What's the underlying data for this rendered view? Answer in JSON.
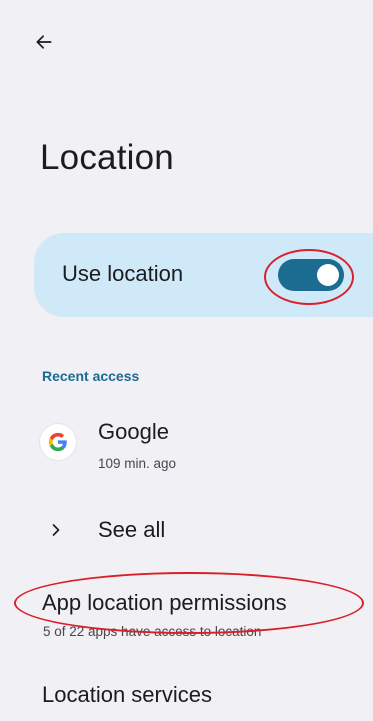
{
  "header": {
    "back_icon": "arrow-back-icon"
  },
  "page": {
    "title": "Location"
  },
  "use_location": {
    "label": "Use location",
    "enabled": true,
    "accent": "#1c6b91",
    "card_color": "#cfe9f8"
  },
  "recent_access": {
    "header": "Recent access",
    "items": [
      {
        "icon": "google-g-icon",
        "name": "Google",
        "time": "109 min. ago"
      }
    ],
    "see_all_label": "See all",
    "see_all_icon": "chevron-right-icon"
  },
  "app_permissions": {
    "title": "App location permissions",
    "subtitle": "5 of 22 apps have access to location"
  },
  "location_services": {
    "title": "Location services"
  },
  "annotations": {
    "color": "#d9202a",
    "highlighted": [
      "use-location-switch",
      "app-location-permissions"
    ]
  }
}
